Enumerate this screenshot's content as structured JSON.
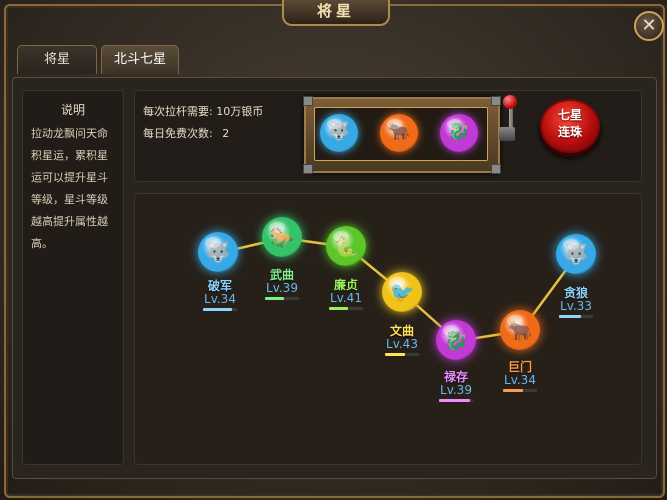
{
  "window": {
    "title": "将星",
    "close_label": "✕"
  },
  "tabs": [
    {
      "label": "将星"
    },
    {
      "label": "北斗七星"
    }
  ],
  "description": {
    "title": "说明",
    "text": "拉动龙飘问天命积星运，累积星运可以提升星斗等级，星斗等级越高提升属性越高。"
  },
  "info": {
    "cost_label": "每次拉杆需要:",
    "cost_value": "10万银币",
    "free_label": "每日免费次数:",
    "free_value": "2"
  },
  "slot_machine": {
    "reels": [
      {
        "icon": "wolf-icon",
        "color": "#36a9e6"
      },
      {
        "icon": "ox-icon",
        "color": "#ef6b18"
      },
      {
        "icon": "dragon-icon",
        "color": "#c23ad6"
      }
    ],
    "lever_icon": "lever-icon",
    "button_label_line1": "七星",
    "button_label_line2": "连珠"
  },
  "stars": [
    {
      "name": "破军",
      "level": "Lv.34",
      "color": "#36a9e6",
      "name_color": "#8fd4ff",
      "icon": "wolf-icon",
      "progress": 0.85
    },
    {
      "name": "武曲",
      "level": "Lv.39",
      "color": "#35c36a",
      "name_color": "#7ff08e",
      "icon": "horse-icon",
      "progress": 0.55
    },
    {
      "name": "廉贞",
      "level": "Lv.41",
      "color": "#5cc62a",
      "name_color": "#9af05f",
      "icon": "snake-icon",
      "progress": 0.55
    },
    {
      "name": "文曲",
      "level": "Lv.43",
      "color": "#f0c21a",
      "name_color": "#ffe15a",
      "icon": "bird-icon",
      "progress": 0.6
    },
    {
      "name": "禄存",
      "level": "Lv.39",
      "color": "#c23ad6",
      "name_color": "#ef8bff",
      "icon": "dragon-icon",
      "progress": 0.9
    },
    {
      "name": "巨门",
      "level": "Lv.34",
      "color": "#ef6b18",
      "name_color": "#ff9a4a",
      "icon": "ox-icon",
      "progress": 0.6
    },
    {
      "name": "贪狼",
      "level": "Lv.33",
      "color": "#36a9e6",
      "name_color": "#8fd4ff",
      "icon": "wolf-icon",
      "progress": 0.65
    }
  ]
}
